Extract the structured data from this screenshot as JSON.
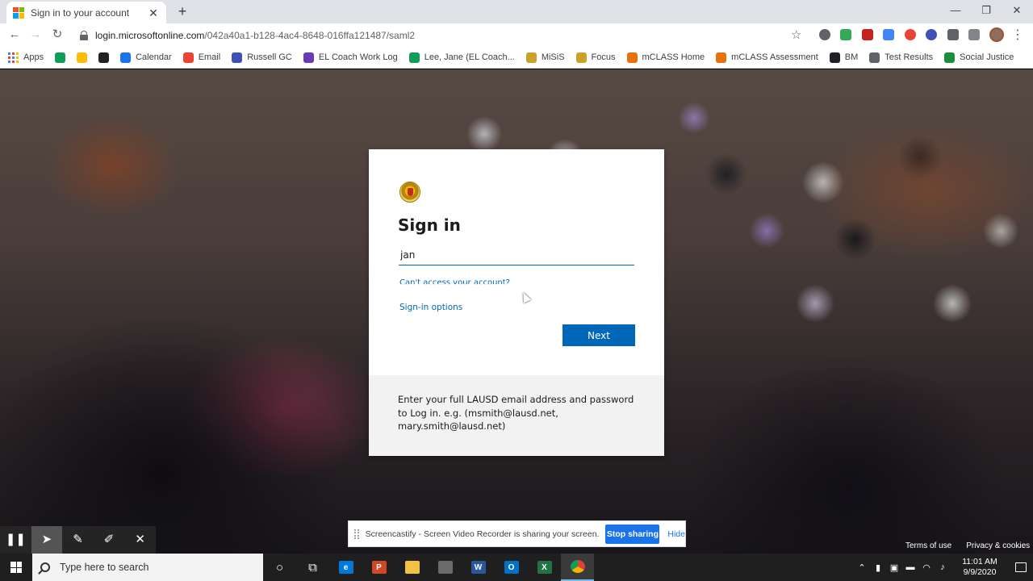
{
  "browser": {
    "tab_title": "Sign in to your account",
    "tab_close": "✕",
    "new_tab": "+",
    "window_controls": {
      "minimize": "—",
      "maximize": "❐",
      "close": "✕"
    },
    "url_host": "login.microsoftonline.com",
    "url_path": "/042a40a1-b128-4ac4-8648-016ffa121487/saml2",
    "nav": {
      "back": "←",
      "forward": "→",
      "reload": "↻"
    }
  },
  "bookmarks": [
    {
      "label": "Apps",
      "color": "#4285f4"
    },
    {
      "label": "",
      "color": "#0f9d58"
    },
    {
      "label": "",
      "color": "#fbbc05"
    },
    {
      "label": "",
      "color": "#202124"
    },
    {
      "label": "Calendar",
      "color": "#1a73e8"
    },
    {
      "label": "Email",
      "color": "#ea4335"
    },
    {
      "label": "Russell GC",
      "color": "#3f51b5"
    },
    {
      "label": "EL Coach Work Log",
      "color": "#673ab7"
    },
    {
      "label": "Lee, Jane (EL Coach...",
      "color": "#0f9d58"
    },
    {
      "label": "MiSiS",
      "color": "#c9a227"
    },
    {
      "label": "Focus",
      "color": "#c9a227"
    },
    {
      "label": "mCLASS Home",
      "color": "#e8710a"
    },
    {
      "label": "mCLASS Assessment",
      "color": "#e8710a"
    },
    {
      "label": "BM",
      "color": "#202124"
    },
    {
      "label": "Test Results",
      "color": "#5f6368"
    },
    {
      "label": "Social Justice",
      "color": "#1e8e3e"
    }
  ],
  "signin": {
    "heading": "Sign in",
    "email_value": "jan",
    "cant_access": "Can't access your account?",
    "signin_options": "Sign-in options",
    "next_label": "Next",
    "footer_text": "Enter your full LAUSD email address and password to Log in. e.g. (msmith@lausd.net, mary.smith@lausd.net)"
  },
  "share_bar": {
    "message": "Screencastify - Screen Video Recorder is sharing your screen.",
    "stop_label": "Stop sharing",
    "hide_label": "Hide"
  },
  "screencastify_tools": [
    "❚❚",
    "➤",
    "✎",
    "✐",
    "✕"
  ],
  "page_links": {
    "terms": "Terms of use",
    "privacy": "Privacy & cookies",
    "more": "..."
  },
  "taskbar": {
    "search_placeholder": "Type here to search",
    "time": "11:01 AM",
    "date": "9/9/2020",
    "apps": [
      {
        "name": "cortana",
        "label": "○",
        "color": "transparent"
      },
      {
        "name": "task-view",
        "label": "⧉",
        "color": "transparent"
      },
      {
        "name": "edge",
        "label": "e",
        "color": "#0078d7"
      },
      {
        "name": "powerpoint",
        "label": "P",
        "color": "#d24726"
      },
      {
        "name": "file-explorer",
        "label": "",
        "color": "#f3c242"
      },
      {
        "name": "store",
        "label": "",
        "color": "#6b6b6b"
      },
      {
        "name": "word",
        "label": "W",
        "color": "#2b579a"
      },
      {
        "name": "outlook",
        "label": "O",
        "color": "#0072c6"
      },
      {
        "name": "excel",
        "label": "X",
        "color": "#217346"
      },
      {
        "name": "chrome",
        "label": "",
        "color": "#db4437"
      }
    ],
    "tray_icons": [
      "⌃",
      "▮",
      "▣",
      "▬",
      "◠",
      "♪"
    ]
  }
}
